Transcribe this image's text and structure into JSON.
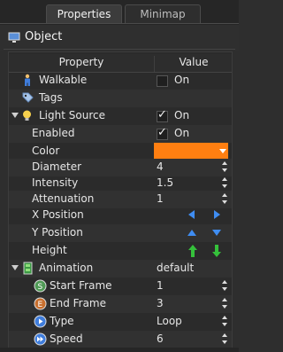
{
  "tabs": {
    "properties": "Properties",
    "minimap": "Minimap"
  },
  "header": {
    "title": "Object"
  },
  "table": {
    "col_property": "Property",
    "col_value": "Value"
  },
  "rows": {
    "walkable": {
      "label": "Walkable",
      "value": "On",
      "checked": false,
      "icon": "walking-person-icon"
    },
    "tags": {
      "label": "Tags",
      "icon": "tag-icon"
    },
    "light_source": {
      "label": "Light Source",
      "value": "On",
      "checked": true,
      "icon": "lightbulb-icon"
    },
    "enabled": {
      "label": "Enabled",
      "value": "On",
      "checked": true
    },
    "color": {
      "label": "Color",
      "value": "#ff7f11"
    },
    "diameter": {
      "label": "Diameter",
      "value": "4"
    },
    "intensity": {
      "label": "Intensity",
      "value": "1.5"
    },
    "attenuation": {
      "label": "Attenuation",
      "value": "1"
    },
    "x_position": {
      "label": "X Position"
    },
    "y_position": {
      "label": "Y Position"
    },
    "height": {
      "label": "Height"
    },
    "animation": {
      "label": "Animation",
      "value": "default",
      "icon": "animation-film-icon"
    },
    "start_frame": {
      "label": "Start Frame",
      "value": "1",
      "icon": "start-frame-icon"
    },
    "end_frame": {
      "label": "End Frame",
      "value": "3",
      "icon": "end-frame-icon"
    },
    "type": {
      "label": "Type",
      "value": "Loop",
      "icon": "play-icon"
    },
    "speed": {
      "label": "Speed",
      "value": "6",
      "icon": "fast-forward-icon"
    }
  },
  "colors": {
    "accent_orange": "#ff7f11",
    "arrow_blue": "#3f8df2",
    "arrow_green": "#35c13b"
  }
}
